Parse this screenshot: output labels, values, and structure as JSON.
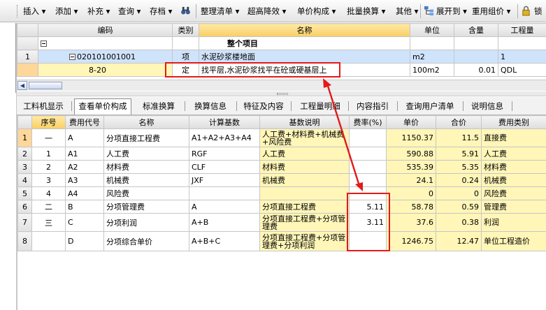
{
  "toolbar": {
    "items": [
      "插入",
      "添加",
      "补充",
      "查询",
      "存档",
      "整理清单",
      "超高降效",
      "单价构成",
      "批量换算",
      "其他",
      "展开到",
      "重用组价",
      "锁"
    ]
  },
  "top_grid": {
    "columns": [
      "编码",
      "类别",
      "名称",
      "单位",
      "含量",
      "工程量"
    ],
    "rows": [
      {
        "no": "",
        "code": "",
        "type": "",
        "name": "整个项目",
        "unit": "",
        "qty": "",
        "amount": ""
      },
      {
        "no": "1",
        "code": "020101001001",
        "type": "项",
        "name": "水泥砂浆楼地面",
        "unit": "m2",
        "qty": "",
        "amount": "1"
      },
      {
        "no": "",
        "code": "8-20",
        "type": "定",
        "name": "找平层,水泥砂浆找平在砼或硬基层上",
        "unit": "100m2",
        "qty": "0.01",
        "amount": "QDL"
      }
    ]
  },
  "tabs": [
    "工料机显示",
    "查看单价构成",
    "标准换算",
    "换算信息",
    "特征及内容",
    "工程量明细",
    "内容指引",
    "查询用户清单",
    "说明信息"
  ],
  "bottom_grid": {
    "columns": [
      "序号",
      "费用代号",
      "名称",
      "计算基数",
      "基数说明",
      "费率(%)",
      "单价",
      "合价",
      "费用类别"
    ],
    "rows": [
      {
        "n": "1",
        "seq": "一",
        "code": "A",
        "name": "分项直接工程费",
        "base": "A1+A2+A3+A4",
        "desc": "人工费+材料费+机械费+风险费",
        "rate": "",
        "price": "1150.37",
        "total": "11.5",
        "cat": "直接费"
      },
      {
        "n": "2",
        "seq": "1",
        "code": "A1",
        "name": "人工费",
        "base": "RGF",
        "desc": "人工费",
        "rate": "",
        "price": "590.88",
        "total": "5.91",
        "cat": "人工费"
      },
      {
        "n": "3",
        "seq": "2",
        "code": "A2",
        "name": "材料费",
        "base": "CLF",
        "desc": "材料费",
        "rate": "",
        "price": "535.39",
        "total": "5.35",
        "cat": "材料费"
      },
      {
        "n": "4",
        "seq": "3",
        "code": "A3",
        "name": "机械费",
        "base": "JXF",
        "desc": "机械费",
        "rate": "",
        "price": "24.1",
        "total": "0.24",
        "cat": "机械费"
      },
      {
        "n": "5",
        "seq": "4",
        "code": "A4",
        "name": "风险费",
        "base": "",
        "desc": "",
        "rate": "",
        "price": "0",
        "total": "0",
        "cat": "风险费"
      },
      {
        "n": "6",
        "seq": "二",
        "code": "B",
        "name": "分项管理费",
        "base": "A",
        "desc": "分项直接工程费",
        "rate": "5.11",
        "price": "58.78",
        "total": "0.59",
        "cat": "管理费"
      },
      {
        "n": "7",
        "seq": "三",
        "code": "C",
        "name": "分项利润",
        "base": "A+B",
        "desc": "分项直接工程费+分项管理费",
        "rate": "3.11",
        "price": "37.6",
        "total": "0.38",
        "cat": "利润"
      },
      {
        "n": "8",
        "seq": "",
        "code": "D",
        "name": "分项综合单价",
        "base": "A+B+C",
        "desc": "分项直接工程费+分项管理费+分项利润",
        "rate": "",
        "price": "1246.75",
        "total": "12.47",
        "cat": "单位工程造价"
      }
    ]
  },
  "colors": {
    "annotation_red": "#e21a1a",
    "row_blue": "#cfe3fb",
    "cell_yellow": "#fff6b8",
    "header_orange": "#f8cf63"
  }
}
